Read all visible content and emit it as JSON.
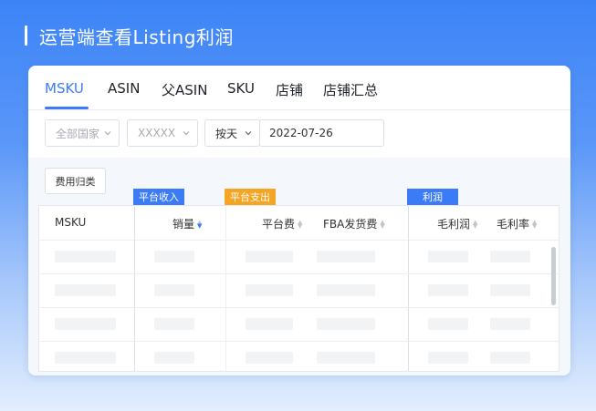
{
  "page": {
    "title": "运营端查看Listing利润"
  },
  "colors": {
    "accent": "#3b7cf6",
    "revenue_tag": "#3b7cf6",
    "expense_tag": "#f5a524",
    "profit_tag": "#3b7cf6"
  },
  "tabs": [
    {
      "label": "MSKU",
      "active": true
    },
    {
      "label": "ASIN",
      "active": false
    },
    {
      "label": "父ASIN",
      "active": false
    },
    {
      "label": "SKU",
      "active": false
    },
    {
      "label": "店铺",
      "active": false
    },
    {
      "label": "店铺汇总",
      "active": false
    }
  ],
  "filters": {
    "country": {
      "placeholder": "全部国家"
    },
    "shop": {
      "placeholder": "XXXXX"
    },
    "period": {
      "value": "按天"
    },
    "date": {
      "value": "2022-07-26"
    }
  },
  "toolbar": {
    "category_button": "费用归类"
  },
  "table": {
    "groups": {
      "revenue": "平台收入",
      "expense": "平台支出",
      "profit": "利润"
    },
    "columns": [
      "MSKU",
      "销量",
      "平台费",
      "FBA发货费",
      "毛利润",
      "毛利率"
    ],
    "sort_active": "销量",
    "placeholder_rows": 4
  }
}
